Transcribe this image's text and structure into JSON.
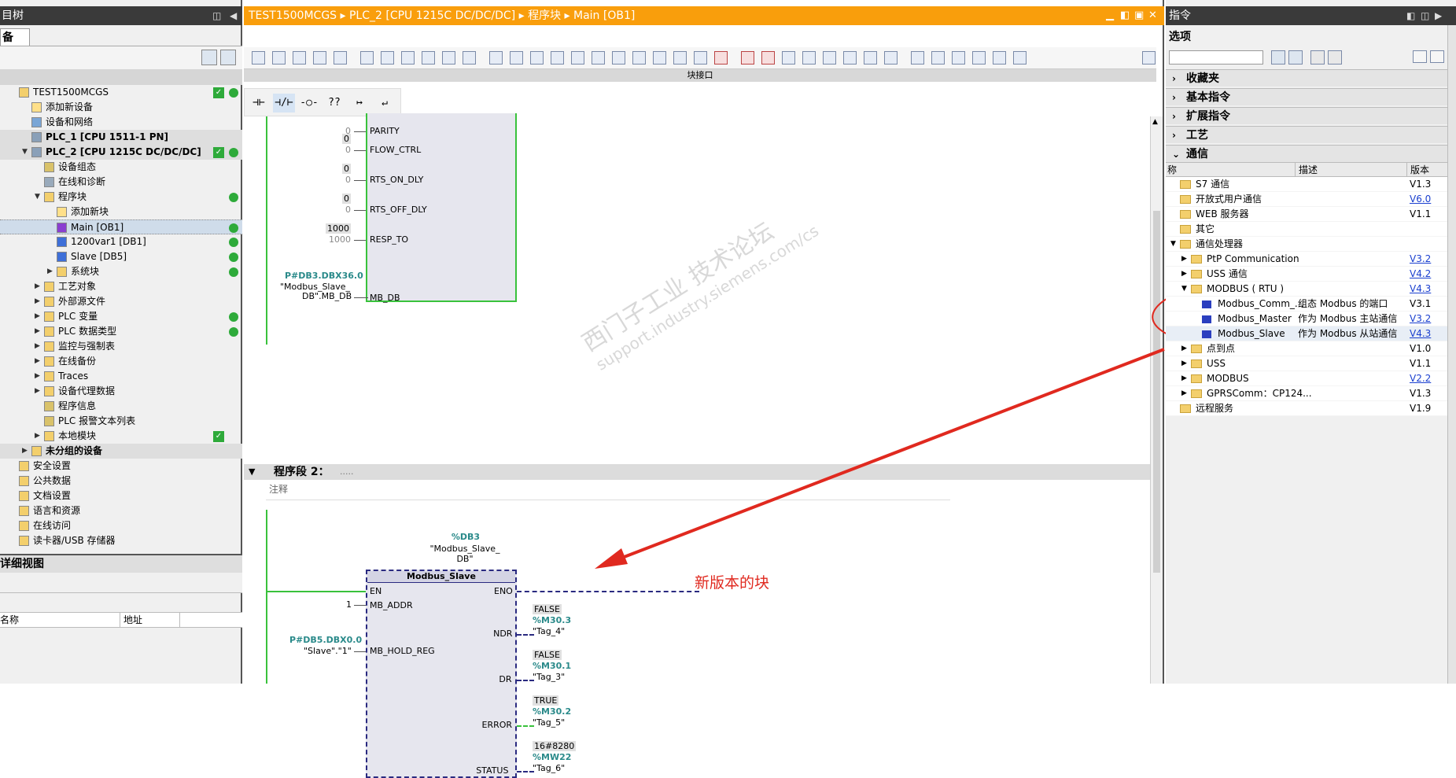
{
  "left": {
    "title": "目树",
    "tab": "备",
    "tree": [
      {
        "label": "TEST1500MCGS",
        "indent": 0,
        "arrow": "",
        "chk": true,
        "dot": true,
        "ico": "folder"
      },
      {
        "label": "添加新设备",
        "indent": 1,
        "arrow": "",
        "ico": "add"
      },
      {
        "label": "设备和网络",
        "indent": 1,
        "arrow": "",
        "ico": "net"
      },
      {
        "label": "PLC_1 [CPU 1511-1 PN]",
        "indent": 1,
        "arrow": "",
        "ico": "plc",
        "grp": true
      },
      {
        "label": "PLC_2 [CPU 1215C DC/DC/DC]",
        "indent": 1,
        "arrow": "▼",
        "chk": true,
        "dot": true,
        "ico": "plc",
        "grp": true
      },
      {
        "label": "设备组态",
        "indent": 2,
        "arrow": "",
        "ico": "cfg"
      },
      {
        "label": "在线和诊断",
        "indent": 2,
        "arrow": "",
        "ico": "diag"
      },
      {
        "label": "程序块",
        "indent": 2,
        "arrow": "▼",
        "dot": true,
        "ico": "folder"
      },
      {
        "label": "添加新块",
        "indent": 3,
        "arrow": "",
        "ico": "add"
      },
      {
        "label": "Main [OB1]",
        "indent": 3,
        "arrow": "",
        "dot": true,
        "ico": "ob",
        "sel": true
      },
      {
        "label": "1200var1 [DB1]",
        "indent": 3,
        "arrow": "",
        "dot": true,
        "ico": "db"
      },
      {
        "label": "Slave [DB5]",
        "indent": 3,
        "arrow": "",
        "dot": true,
        "ico": "db"
      },
      {
        "label": "系统块",
        "indent": 3,
        "arrow": "▶",
        "dot": true,
        "ico": "folder"
      },
      {
        "label": "工艺对象",
        "indent": 2,
        "arrow": "▶",
        "ico": "folder"
      },
      {
        "label": "外部源文件",
        "indent": 2,
        "arrow": "▶",
        "ico": "folder"
      },
      {
        "label": "PLC 变量",
        "indent": 2,
        "arrow": "▶",
        "dot": true,
        "ico": "folder"
      },
      {
        "label": "PLC 数据类型",
        "indent": 2,
        "arrow": "▶",
        "dot": true,
        "ico": "folder"
      },
      {
        "label": "监控与强制表",
        "indent": 2,
        "arrow": "▶",
        "ico": "folder"
      },
      {
        "label": "在线备份",
        "indent": 2,
        "arrow": "▶",
        "ico": "folder"
      },
      {
        "label": "Traces",
        "indent": 2,
        "arrow": "▶",
        "ico": "folder"
      },
      {
        "label": "设备代理数据",
        "indent": 2,
        "arrow": "▶",
        "ico": "folder"
      },
      {
        "label": "程序信息",
        "indent": 2,
        "arrow": "",
        "ico": "cfg"
      },
      {
        "label": "PLC 报警文本列表",
        "indent": 2,
        "arrow": "",
        "ico": "cfg"
      },
      {
        "label": "本地模块",
        "indent": 2,
        "arrow": "▶",
        "chk": true,
        "ico": "folder"
      },
      {
        "label": "未分组的设备",
        "indent": 1,
        "arrow": "▶",
        "ico": "folder",
        "grp": true
      },
      {
        "label": "安全设置",
        "indent": 0,
        "arrow": "",
        "ico": "folder"
      },
      {
        "label": "公共数据",
        "indent": 0,
        "arrow": "",
        "ico": "folder"
      },
      {
        "label": "文档设置",
        "indent": 0,
        "arrow": "",
        "ico": "folder"
      },
      {
        "label": "语言和资源",
        "indent": 0,
        "arrow": "",
        "ico": "folder"
      },
      {
        "label": "在线访问",
        "indent": 0,
        "arrow": "",
        "ico": "folder"
      },
      {
        "label": "读卡器/USB 存储器",
        "indent": 0,
        "arrow": "",
        "ico": "folder"
      }
    ],
    "detail_title": "详细视图",
    "detail_col_name": "名称",
    "detail_col_addr": "地址"
  },
  "center": {
    "title": "TEST1500MCGS ▸ PLC_2 [CPU 1215C DC/DC/DC] ▸ 程序块 ▸ Main [OB1]",
    "block_interface": "块接口",
    "ladder_buttons": [
      "⊣⊢",
      "⊣/⊢",
      "-○-",
      "??",
      "↦",
      "↵"
    ],
    "upper_block": {
      "pins": [
        {
          "name": "PARITY",
          "val": "0",
          "ghost": "0"
        },
        {
          "name": "FLOW_CTRL",
          "val": "0",
          "ghost": "0"
        },
        {
          "name": "RTS_ON_DLY",
          "val": "0",
          "ghost": "0"
        },
        {
          "name": "RTS_OFF_DLY",
          "val": "0",
          "ghost": "0"
        },
        {
          "name": "RESP_TO",
          "val": "1000",
          "ghost": "1000"
        }
      ],
      "mbdb_addr": "P#DB3.DBX36.0",
      "mbdb_sym1": "\"Modbus_Slave_",
      "mbdb_sym2": "DB\".MB_DB",
      "mbdb_pin": "MB_DB"
    },
    "segment2": {
      "header": "程序段 2：",
      "dots": ".....",
      "comment": "注释",
      "db_addr": "%DB3",
      "db_name1": "\"Modbus_Slave_",
      "db_name2": "DB\"",
      "block_name": "Modbus_Slave",
      "en": "EN",
      "eno": "ENO",
      "mb_addr_pin": "MB_ADDR",
      "mb_addr_val": "1",
      "hold_reg_pin": "MB_HOLD_REG",
      "hold_reg_addr": "P#DB5.DBX0.0",
      "hold_reg_sym": "\"Slave\".\"1\"",
      "outputs": [
        {
          "pin": "NDR",
          "state": "FALSE",
          "addr": "%M30.3",
          "tag": "\"Tag_4\""
        },
        {
          "pin": "DR",
          "state": "FALSE",
          "addr": "%M30.1",
          "tag": "\"Tag_3\""
        },
        {
          "pin": "ERROR",
          "state": "TRUE",
          "addr": "%M30.2",
          "tag": "\"Tag_5\""
        },
        {
          "pin": "STATUS",
          "state": "16#8280",
          "addr": "%MW22",
          "tag": "\"Tag_6\""
        }
      ]
    },
    "annotation": "新版本的块",
    "watermark1": "西门子工业  技术论坛",
    "watermark2": "support.industry.siemens.com/cs"
  },
  "right": {
    "title": "指令",
    "options_label": "选项",
    "sections": [
      "收藏夹",
      "基本指令",
      "扩展指令",
      "工艺",
      "通信"
    ],
    "col_name": "称",
    "col_desc": "描述",
    "col_ver": "版本",
    "rows": [
      {
        "indent": 0,
        "arrow": "",
        "icon": "folder",
        "name": "S7 通信",
        "desc": "",
        "ver": "V1.3",
        "link": false
      },
      {
        "indent": 0,
        "arrow": "",
        "icon": "folder",
        "name": "开放式用户通信",
        "desc": "",
        "ver": "V6.0",
        "link": true
      },
      {
        "indent": 0,
        "arrow": "",
        "icon": "folder",
        "name": "WEB 服务器",
        "desc": "",
        "ver": "V1.1",
        "link": false
      },
      {
        "indent": 0,
        "arrow": "",
        "icon": "folder",
        "name": "其它",
        "desc": "",
        "ver": "",
        "link": false
      },
      {
        "indent": 0,
        "arrow": "▼",
        "icon": "folder",
        "name": "通信处理器",
        "desc": "",
        "ver": "",
        "link": false
      },
      {
        "indent": 1,
        "arrow": "▶",
        "icon": "folder",
        "name": "PtP Communication",
        "desc": "",
        "ver": "V3.2",
        "link": true
      },
      {
        "indent": 1,
        "arrow": "▶",
        "icon": "folder",
        "name": "USS 通信",
        "desc": "",
        "ver": "V4.2",
        "link": true
      },
      {
        "indent": 1,
        "arrow": "▼",
        "icon": "folder",
        "name": "MODBUS ( RTU )",
        "desc": "",
        "ver": "V4.3",
        "link": true
      },
      {
        "indent": 2,
        "arrow": "",
        "icon": "block",
        "name": "Modbus_Comm_...",
        "desc": "组态 Modbus 的端口",
        "ver": "V3.1",
        "link": false
      },
      {
        "indent": 2,
        "arrow": "",
        "icon": "block",
        "name": "Modbus_Master",
        "desc": "作为 Modbus 主站通信",
        "ver": "V3.2",
        "link": true
      },
      {
        "indent": 2,
        "arrow": "",
        "icon": "block",
        "name": "Modbus_Slave",
        "desc": "作为 Modbus 从站通信",
        "ver": "V4.3",
        "link": true
      },
      {
        "indent": 1,
        "arrow": "▶",
        "icon": "folder",
        "name": "点到点",
        "desc": "",
        "ver": "V1.0",
        "link": false
      },
      {
        "indent": 1,
        "arrow": "▶",
        "icon": "folder",
        "name": "USS",
        "desc": "",
        "ver": "V1.1",
        "link": false
      },
      {
        "indent": 1,
        "arrow": "▶",
        "icon": "folder",
        "name": "MODBUS",
        "desc": "",
        "ver": "V2.2",
        "link": true
      },
      {
        "indent": 1,
        "arrow": "▶",
        "icon": "folder",
        "name": "GPRSComm：CP124...",
        "desc": "",
        "ver": "V1.3",
        "link": false
      },
      {
        "indent": 0,
        "arrow": "",
        "icon": "folder",
        "name": "远程服务",
        "desc": "",
        "ver": "V1.9",
        "link": false
      }
    ]
  },
  "colors": {
    "accent": "#f99e0c",
    "ok": "#2eaa3a",
    "annotation": "#e0291f",
    "wire": "#39c23c",
    "link": "#1a3fcf"
  }
}
